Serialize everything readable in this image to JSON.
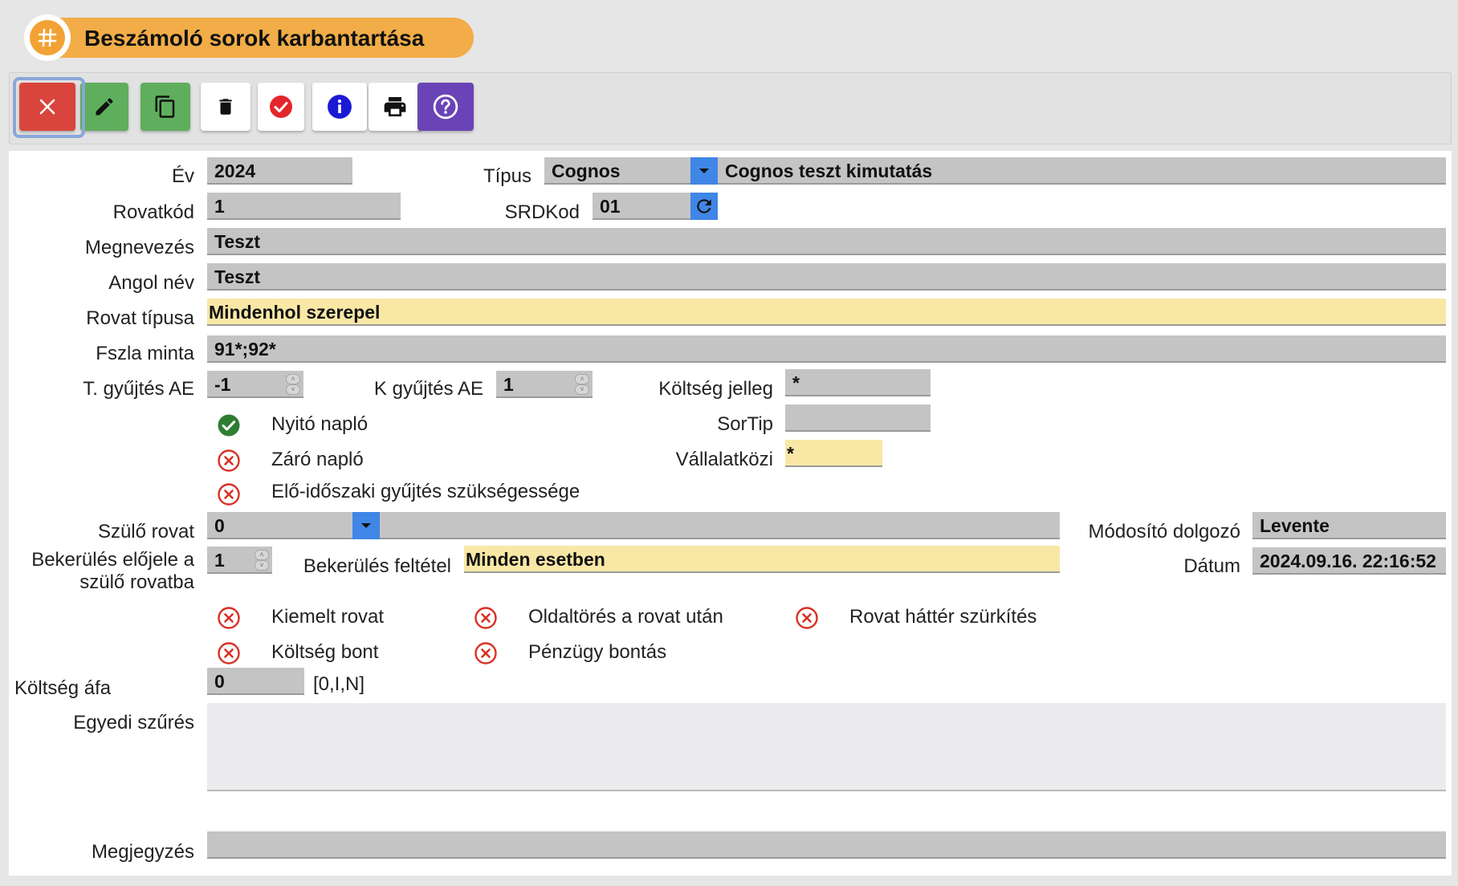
{
  "title": "Beszámoló sorok karbantartása",
  "toolbar": {
    "buttons": [
      "close",
      "edit",
      "copy",
      "delete",
      "approve",
      "info",
      "print",
      "help"
    ]
  },
  "colors": {
    "title_pill": "#f2ad48",
    "field_gray": "#c4c4c4",
    "field_yellow": "#f9e7a6",
    "dropdown_blue": "#3f86e6",
    "checked_green": "#2e7d32",
    "unchecked_red": "#d93025"
  },
  "form": {
    "ev": {
      "label": "Év",
      "value": "2024"
    },
    "tipus": {
      "label": "Típus",
      "value": "Cognos",
      "description": "Cognos teszt kimutatás"
    },
    "rovatkod": {
      "label": "Rovatkód",
      "value": "1"
    },
    "srdkod": {
      "label": "SRDKod",
      "value": "01"
    },
    "megnevezes": {
      "label": "Megnevezés",
      "value": "Teszt"
    },
    "angol_nev": {
      "label": "Angol név",
      "value": "Teszt"
    },
    "rovat_tipusa": {
      "label": "Rovat típusa",
      "value": "Mindenhol szerepel"
    },
    "fszla_minta": {
      "label": "Fszla minta",
      "value": "91*;92*"
    },
    "t_gyujtes_ae": {
      "label": "T. gyűjtés AE",
      "value": "-1"
    },
    "k_gyujtes_ae": {
      "label": "K gyűjtés AE",
      "value": "1"
    },
    "koltseg_jelleg": {
      "label": "Költség jelleg",
      "value": "*"
    },
    "sortip": {
      "label": "SorTip",
      "value": ""
    },
    "vallalatkozi": {
      "label": "Vállalatközi",
      "value": "*"
    },
    "nyito_naplo": {
      "label": "Nyitó napló",
      "checked": true
    },
    "zaro_naplo": {
      "label": "Záró napló",
      "checked": false
    },
    "elo_idoszaki": {
      "label": "Elő-időszaki gyűjtés szükségessége",
      "checked": false
    },
    "szulo_rovat": {
      "label": "Szülő rovat",
      "value": "0"
    },
    "modosito_dolgozo": {
      "label": "Módosító dolgozó",
      "value": "Levente"
    },
    "bekerules_elojele": {
      "label_line1": "Bekerülés előjele a",
      "label_line2": "szülő rovatba",
      "value": "1"
    },
    "bekerules_feltetel": {
      "label": "Bekerülés feltétel",
      "value": "Minden esetben"
    },
    "datum": {
      "label": "Dátum",
      "value": "2024.09.16. 22:16:52"
    },
    "kiemelt_rovat": {
      "label": "Kiemelt rovat",
      "checked": false
    },
    "oldaltores": {
      "label": "Oldaltörés a rovat után",
      "checked": false
    },
    "rovat_hatter": {
      "label": "Rovat háttér szürkítés",
      "checked": false
    },
    "koltseg_bont": {
      "label": "Költség bont",
      "checked": false
    },
    "penzugy_bontas": {
      "label": "Pénzügy bontás",
      "checked": false
    },
    "koltseg_afa": {
      "label": "Költség áfa",
      "value": "0",
      "hint": "[0,I,N]"
    },
    "egyedi_szures": {
      "label": "Egyedi szűrés",
      "value": ""
    },
    "megjegyzes": {
      "label": "Megjegyzés",
      "value": ""
    }
  }
}
